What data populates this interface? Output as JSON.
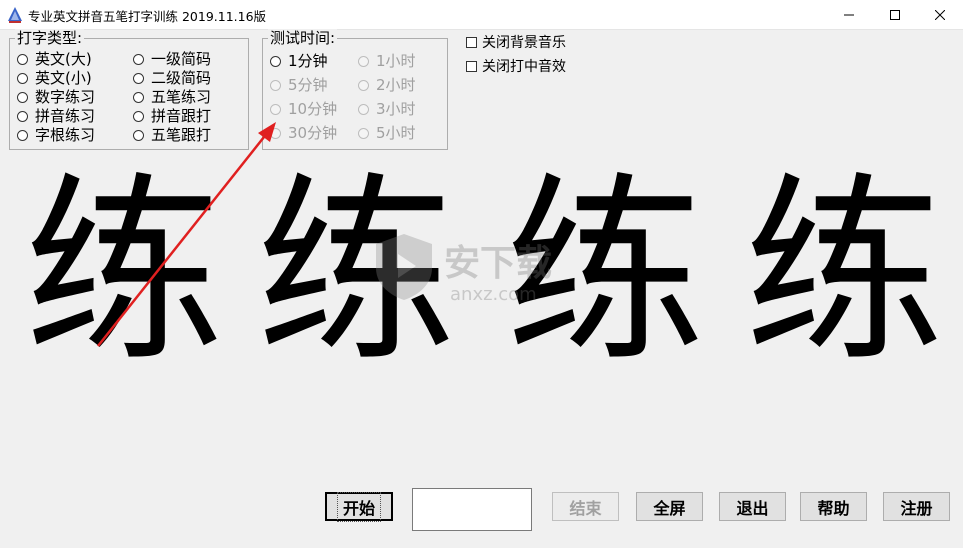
{
  "window": {
    "title": "专业英文拼音五笔打字训练  2019.11.16版",
    "controls": [
      "minimize",
      "maximize",
      "close"
    ]
  },
  "typing_type": {
    "legend": "打字类型:",
    "options": [
      "英文(大)",
      "一级简码",
      "英文(小)",
      "二级简码",
      "数字练习",
      "五笔练习",
      "拼音练习",
      "拼音跟打",
      "字根练习",
      "五笔跟打"
    ]
  },
  "test_time": {
    "legend": "测试时间:",
    "options": [
      "1分钟",
      "1小时",
      "5分钟",
      "2小时",
      "10分钟",
      "3小时",
      "30分钟",
      "5小时"
    ]
  },
  "sound": {
    "close_bg_music": "关闭背景音乐",
    "close_hit_sound": "关闭打中音效"
  },
  "practice": {
    "chars": [
      "练",
      "练",
      "练",
      "练"
    ]
  },
  "watermark": {
    "title": "安下载",
    "site": "anxz.com"
  },
  "typing_input": {
    "value": ""
  },
  "buttons": {
    "start": "开始",
    "end": "结束",
    "fullscreen": "全屏",
    "exit": "退出",
    "help": "帮助",
    "register": "注册"
  },
  "colors": {
    "annotation_arrow": "#e02020",
    "disabled_text": "#a0a0a0"
  }
}
